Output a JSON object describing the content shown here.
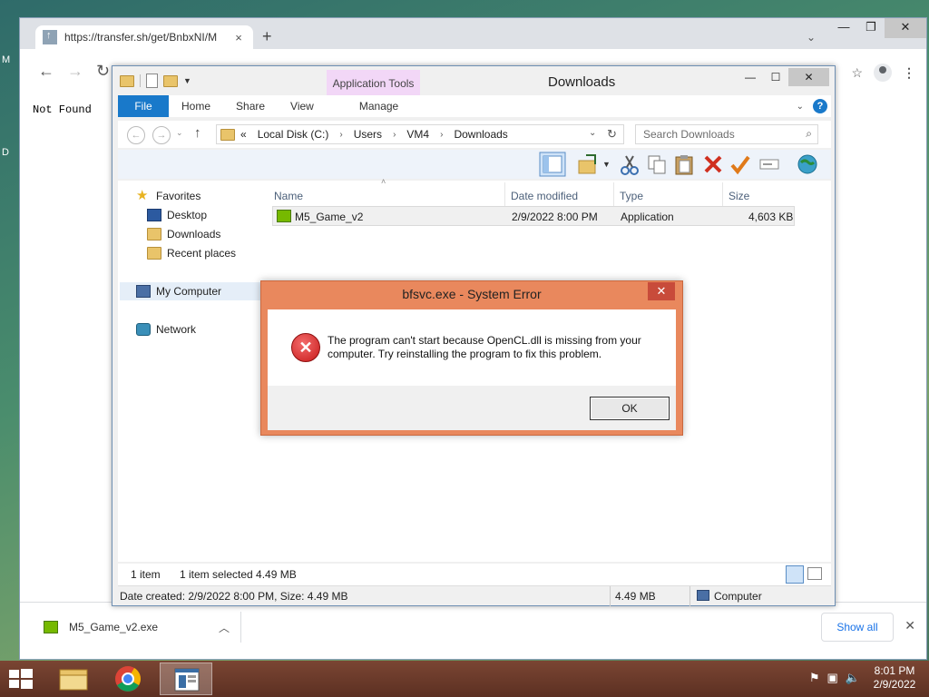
{
  "desktop": {
    "edge_letter_top": "M",
    "edge_letter_bottom": "D"
  },
  "chrome": {
    "tab_title": "https://transfer.sh/get/BnbxNI/M",
    "tab_close": "×",
    "new_tab": "+",
    "tab_list": "⌄",
    "page_text": "Not Found",
    "download": {
      "file_name": "M5_Game_v2.exe",
      "show_all": "Show all"
    }
  },
  "explorer": {
    "title": "Downloads",
    "contextual_tab": "Application Tools",
    "ribbon_tabs": [
      "File",
      "Home",
      "Share",
      "View",
      "Manage"
    ],
    "address": {
      "overflow": "«",
      "segments": [
        "Local Disk (C:)",
        "Users",
        "VM4",
        "Downloads"
      ]
    },
    "search_placeholder": "Search Downloads",
    "nav": {
      "favorites": "Favorites",
      "desktop": "Desktop",
      "downloads": "Downloads",
      "recent": "Recent places",
      "my_computer": "My Computer",
      "network": "Network"
    },
    "columns": {
      "name": "Name",
      "date": "Date modified",
      "type": "Type",
      "size": "Size"
    },
    "file": {
      "name": "M5_Game_v2",
      "date": "2/9/2022 8:00 PM",
      "type": "Application",
      "size": "4,603 KB"
    },
    "status": {
      "items": "1 item",
      "selected": "1 item selected  4.49 MB"
    },
    "details_bar": {
      "created": "Date created: 2/9/2022 8:00 PM, Size: 4.49 MB",
      "size": "4.49 MB",
      "location": "Computer"
    }
  },
  "error_dialog": {
    "title": "bfsvc.exe - System Error",
    "message": "The program can't start because OpenCL.dll is missing from your computer. Try reinstalling the program to fix this problem.",
    "ok": "OK"
  },
  "taskbar": {
    "time": "8:01 PM",
    "date": "2/9/2022"
  },
  "colors": {
    "file_tab": "#1979ca",
    "application_tools": "#f2d7f7",
    "dialog_frame": "#e9885d",
    "taskbar": "#6b3a2a"
  }
}
